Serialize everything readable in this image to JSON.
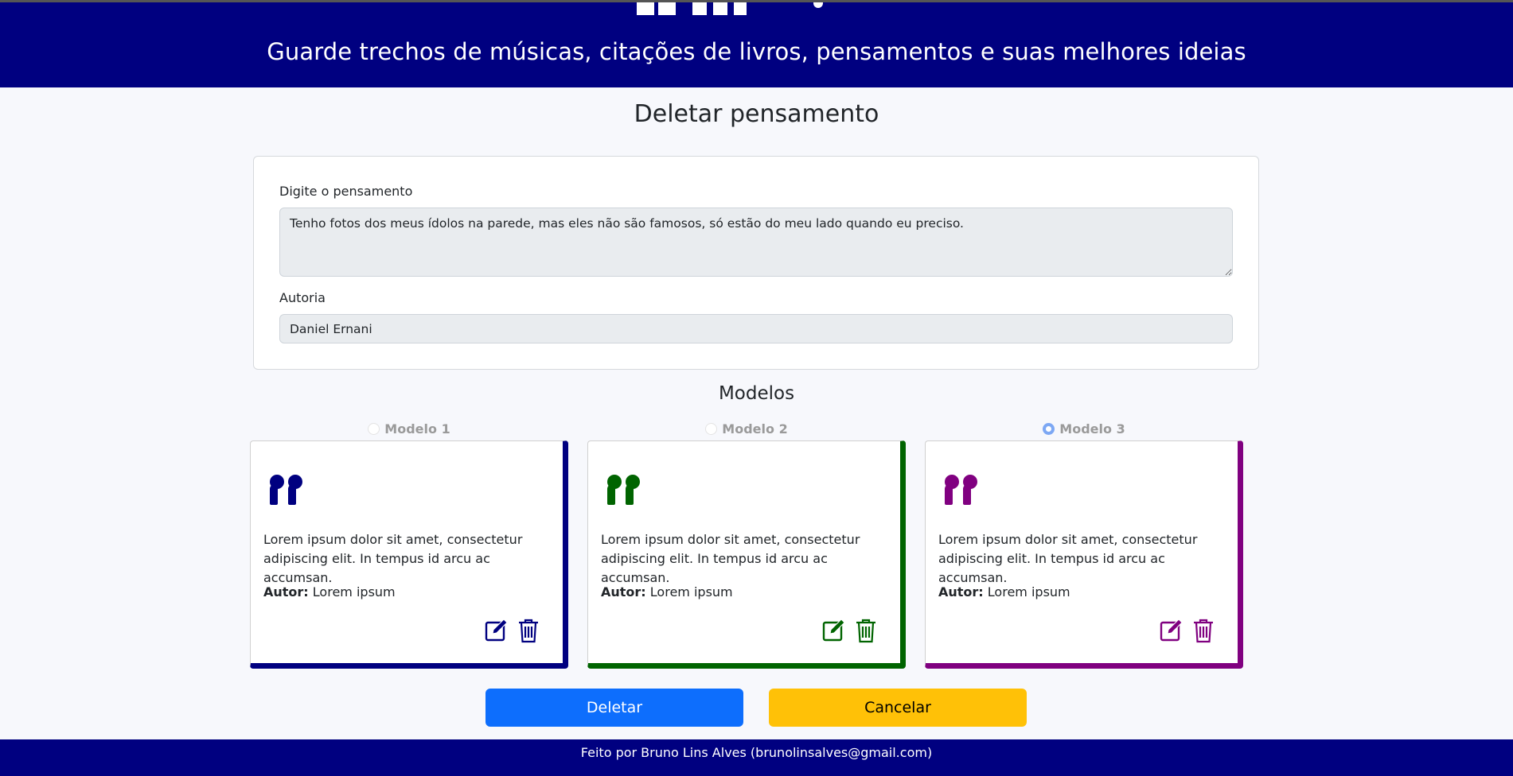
{
  "header": {
    "subtitle": "Guarde trechos de músicas, citações de livros, pensamentos e suas melhores ideias"
  },
  "page_title": "Deletar pensamento",
  "form": {
    "thought_label": "Digite o pensamento",
    "thought_value": "Tenho fotos dos meus ídolos na parede, mas eles não são famosos, só estão do meu lado quando eu preciso.",
    "author_label": "Autoria",
    "author_value": "Daniel Ernani"
  },
  "models": {
    "title": "Modelos",
    "items": [
      {
        "label": "Modelo 1",
        "checked": false,
        "color": "#000080",
        "text": "Lorem ipsum dolor sit amet, consectetur adipiscing elit. In tempus id arcu ac accumsan.",
        "author_prefix": "Autor:",
        "author": "Lorem ipsum",
        "icons": [
          "quote-icon",
          "edit-icon",
          "trash-icon"
        ]
      },
      {
        "label": "Modelo 2",
        "checked": false,
        "color": "#006400",
        "text": "Lorem ipsum dolor sit amet, consectetur adipiscing elit. In tempus id arcu ac accumsan.",
        "author_prefix": "Autor:",
        "author": "Lorem ipsum",
        "icons": [
          "quote-icon",
          "edit-icon",
          "trash-icon"
        ]
      },
      {
        "label": "Modelo 3",
        "checked": true,
        "color": "#800080",
        "text": "Lorem ipsum dolor sit amet, consectetur adipiscing elit. In tempus id arcu ac accumsan.",
        "author_prefix": "Autor:",
        "author": "Lorem ipsum",
        "icons": [
          "quote-icon",
          "edit-icon",
          "trash-icon"
        ]
      }
    ]
  },
  "buttons": {
    "delete_label": "Deletar",
    "cancel_label": "Cancelar"
  },
  "colors": {
    "header_bg": "#000080",
    "delete_button": "#0d6efd",
    "cancel_button": "#ffc107"
  },
  "footer": {
    "text": "Feito por Bruno Lins Alves (brunolinsalves@gmail.com)"
  }
}
